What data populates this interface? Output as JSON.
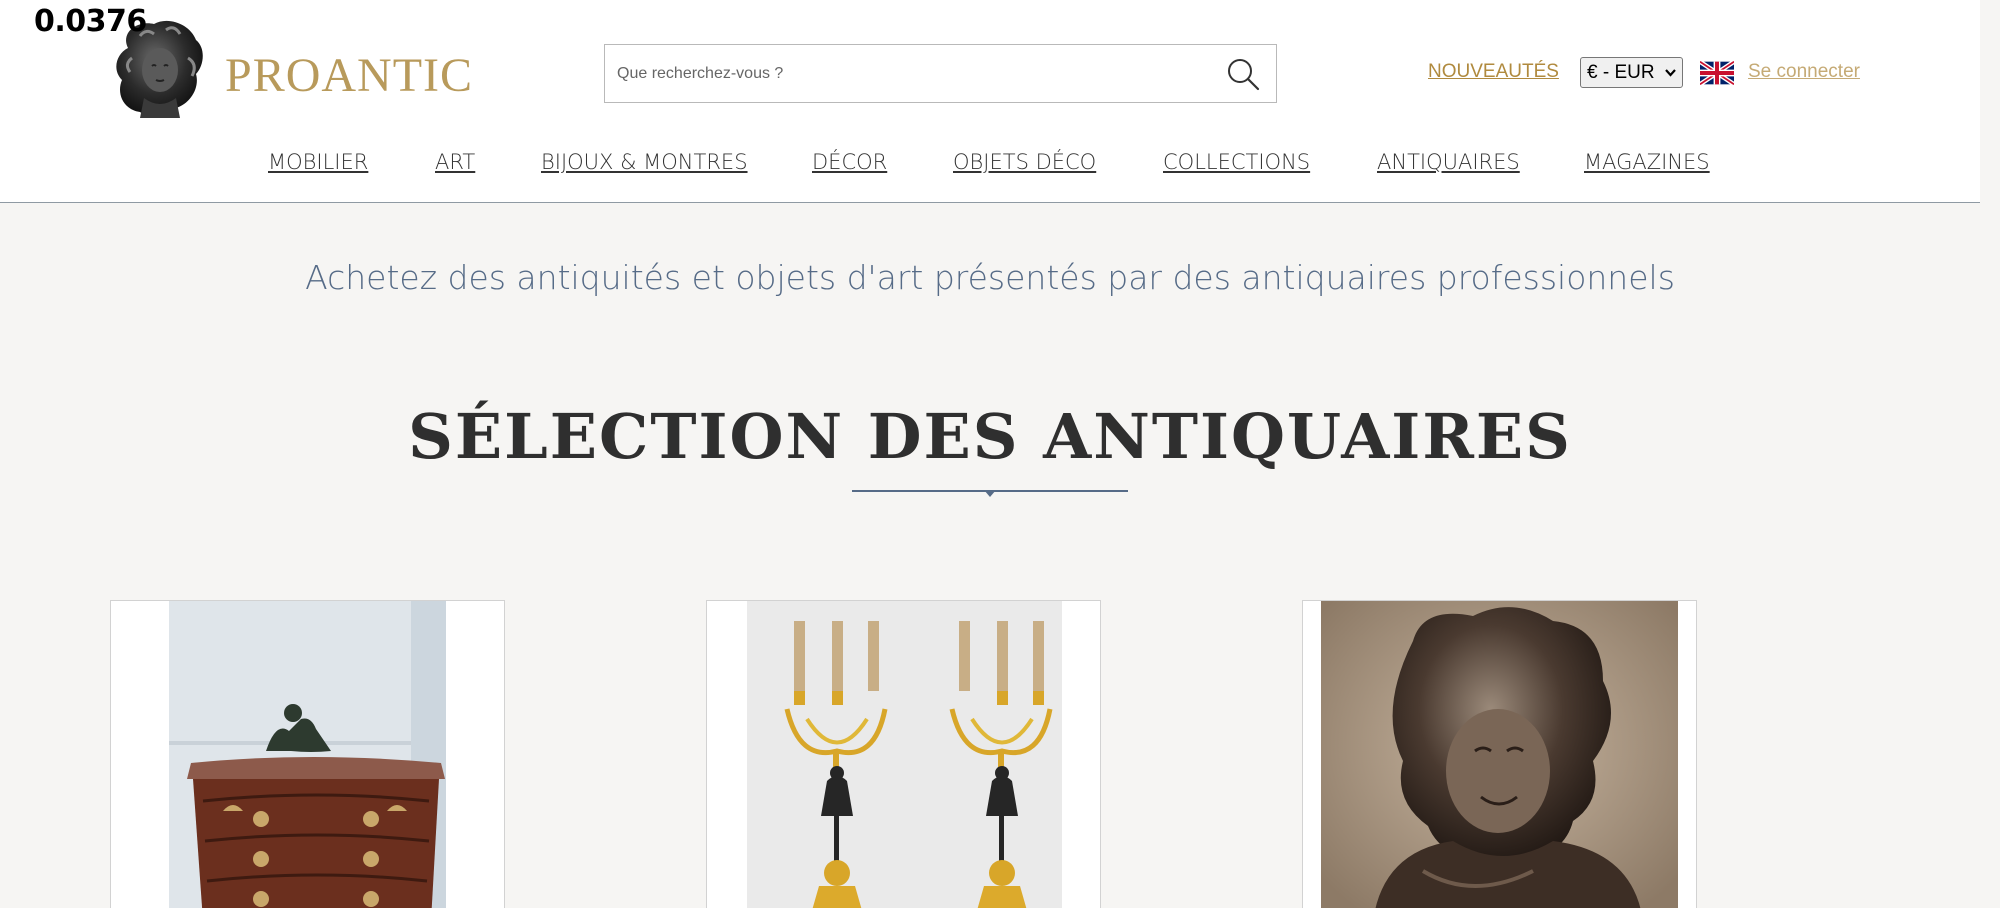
{
  "overlay": {
    "value": "0.0376"
  },
  "brand": {
    "name": "PROANTIC",
    "color": "#b89a5b"
  },
  "search": {
    "placeholder": "Que recherchez-vous ?",
    "icon": "search-icon"
  },
  "header": {
    "nouveautes_label": "NOUVEAUTÉS",
    "currency_selected": "€ - EUR",
    "language_flag": "uk-flag-icon",
    "login_label": "Se connecter"
  },
  "nav": {
    "items": [
      {
        "label": "MOBILIER"
      },
      {
        "label": "ART"
      },
      {
        "label": "BIJOUX & MONTRES"
      },
      {
        "label": "DÉCOR"
      },
      {
        "label": "OBJETS DÉCO"
      },
      {
        "label": "COLLECTIONS"
      },
      {
        "label": "ANTIQUAIRES"
      },
      {
        "label": "MAGAZINES"
      }
    ]
  },
  "main": {
    "tagline": "Achetez des antiquités et objets d'art présentés par des antiquaires professionnels",
    "section_title": "SÉLECTION DES ANTIQUAIRES"
  },
  "products": [
    {
      "name": "commode-with-bronze-reclining-figure"
    },
    {
      "name": "pair-of-gilt-bronze-candelabra"
    },
    {
      "name": "bronze-bust-of-bacchante"
    }
  ],
  "colors": {
    "accent_gold": "#b08a3e",
    "link_light_gold": "#c5aa75",
    "slate_blue": "#566b87",
    "page_background": "#f6f5f3"
  }
}
